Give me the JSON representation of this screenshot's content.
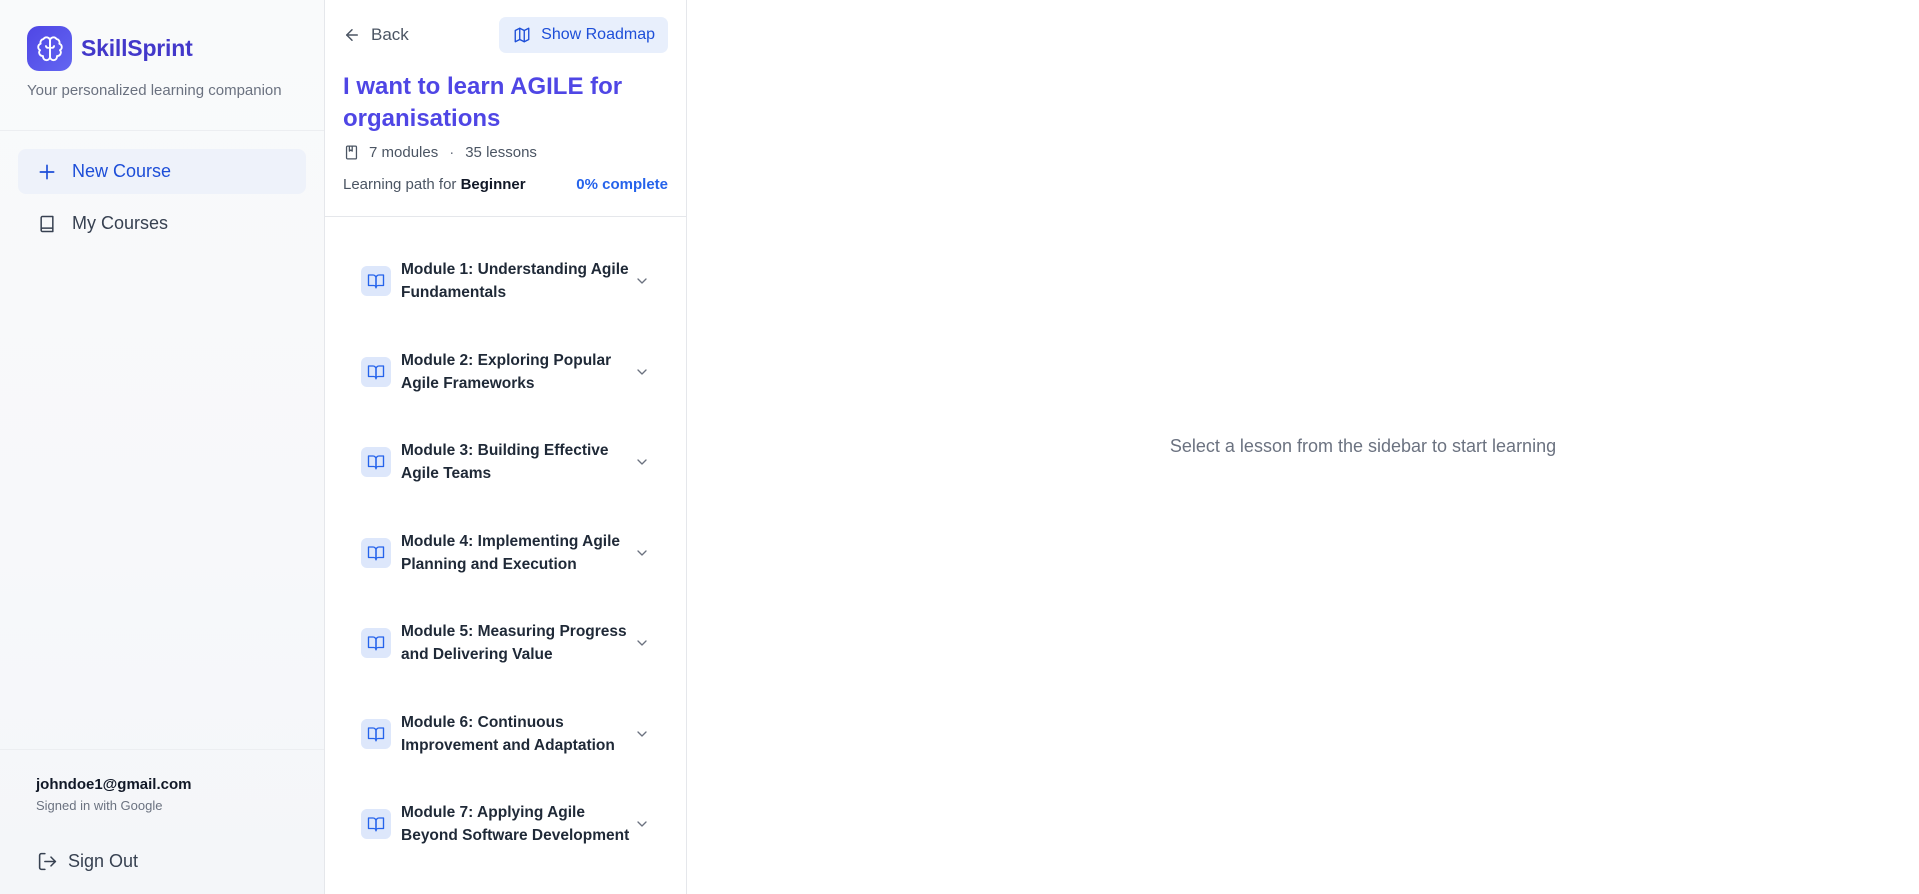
{
  "brand": {
    "name": "SkillSprint",
    "tagline": "Your personalized learning companion",
    "logo_icon": "brain-icon",
    "accent": "#4f46e5"
  },
  "nav": {
    "items": [
      {
        "label": "New Course",
        "icon": "plus-icon",
        "active": true
      },
      {
        "label": "My Courses",
        "icon": "book-icon",
        "active": false
      }
    ]
  },
  "user": {
    "email": "johndoe1@gmail.com",
    "provider": "Signed in with Google",
    "sign_out_label": "Sign Out"
  },
  "course": {
    "back_label": "Back",
    "roadmap_label": "Show Roadmap",
    "title": "I want to learn AGILE for organisations",
    "modules_count": "7 modules",
    "lessons_count": "35 lessons",
    "meta_separator": "·",
    "path_prefix": "Learning path for",
    "level": "Beginner",
    "progress_text": "0% complete",
    "progress": 0,
    "modules": [
      {
        "name": "Module 1: Understanding Agile Fundamentals"
      },
      {
        "name": "Module 2: Exploring Popular Agile Frameworks"
      },
      {
        "name": "Module 3: Building Effective Agile Teams"
      },
      {
        "name": "Module 4: Implementing Agile Planning and Execution"
      },
      {
        "name": "Module 5: Measuring Progress and Delivering Value"
      },
      {
        "name": "Module 6: Continuous Improvement and Adaptation"
      },
      {
        "name": "Module 7: Applying Agile Beyond Software Development"
      }
    ]
  },
  "main": {
    "empty_message": "Select a lesson from the sidebar to start learning"
  }
}
